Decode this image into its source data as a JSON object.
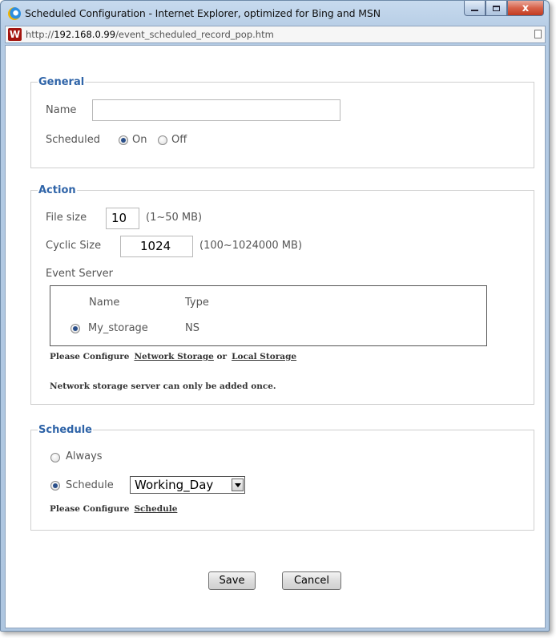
{
  "window": {
    "title": "Scheduled Configuration - Internet Explorer, optimized for Bing and MSN",
    "close_glyph": "x",
    "controls": [
      "minimize-icon",
      "maximize-icon",
      "close-icon"
    ]
  },
  "address_bar": {
    "favicon_text": "W",
    "url_prefix": "http://",
    "url_host": "192.168.0.99",
    "url_path": "/event_scheduled_record_pop.htm"
  },
  "general": {
    "legend": "General",
    "name_label": "Name",
    "name_value": "",
    "scheduled_label": "Scheduled",
    "on_label": "On",
    "off_label": "Off",
    "scheduled_selected": "On"
  },
  "action": {
    "legend": "Action",
    "file_size_label": "File size",
    "file_size_value": "10",
    "file_size_hint": "(1~50 MB)",
    "cyclic_size_label": "Cyclic Size",
    "cyclic_size_value": "1024",
    "cyclic_size_hint": "(100~1024000 MB)",
    "event_server_label": "Event Server",
    "server_table": {
      "headers": [
        "Name",
        "Type"
      ],
      "rows": [
        {
          "name": "My_storage",
          "type": "NS",
          "selected": true
        }
      ]
    },
    "configure_prefix": "Please Configure",
    "network_storage_link": "Network Storage",
    "or_text": "or",
    "local_storage_link": "Local Storage",
    "note": "Network storage server can only be added once."
  },
  "schedule": {
    "legend": "Schedule",
    "always_label": "Always",
    "schedule_label": "Schedule",
    "selected_option": "Schedule",
    "schedule_value": "Working_Day",
    "configure_prefix": "Please Configure",
    "schedule_link": "Schedule"
  },
  "buttons": {
    "save": "Save",
    "cancel": "Cancel"
  }
}
